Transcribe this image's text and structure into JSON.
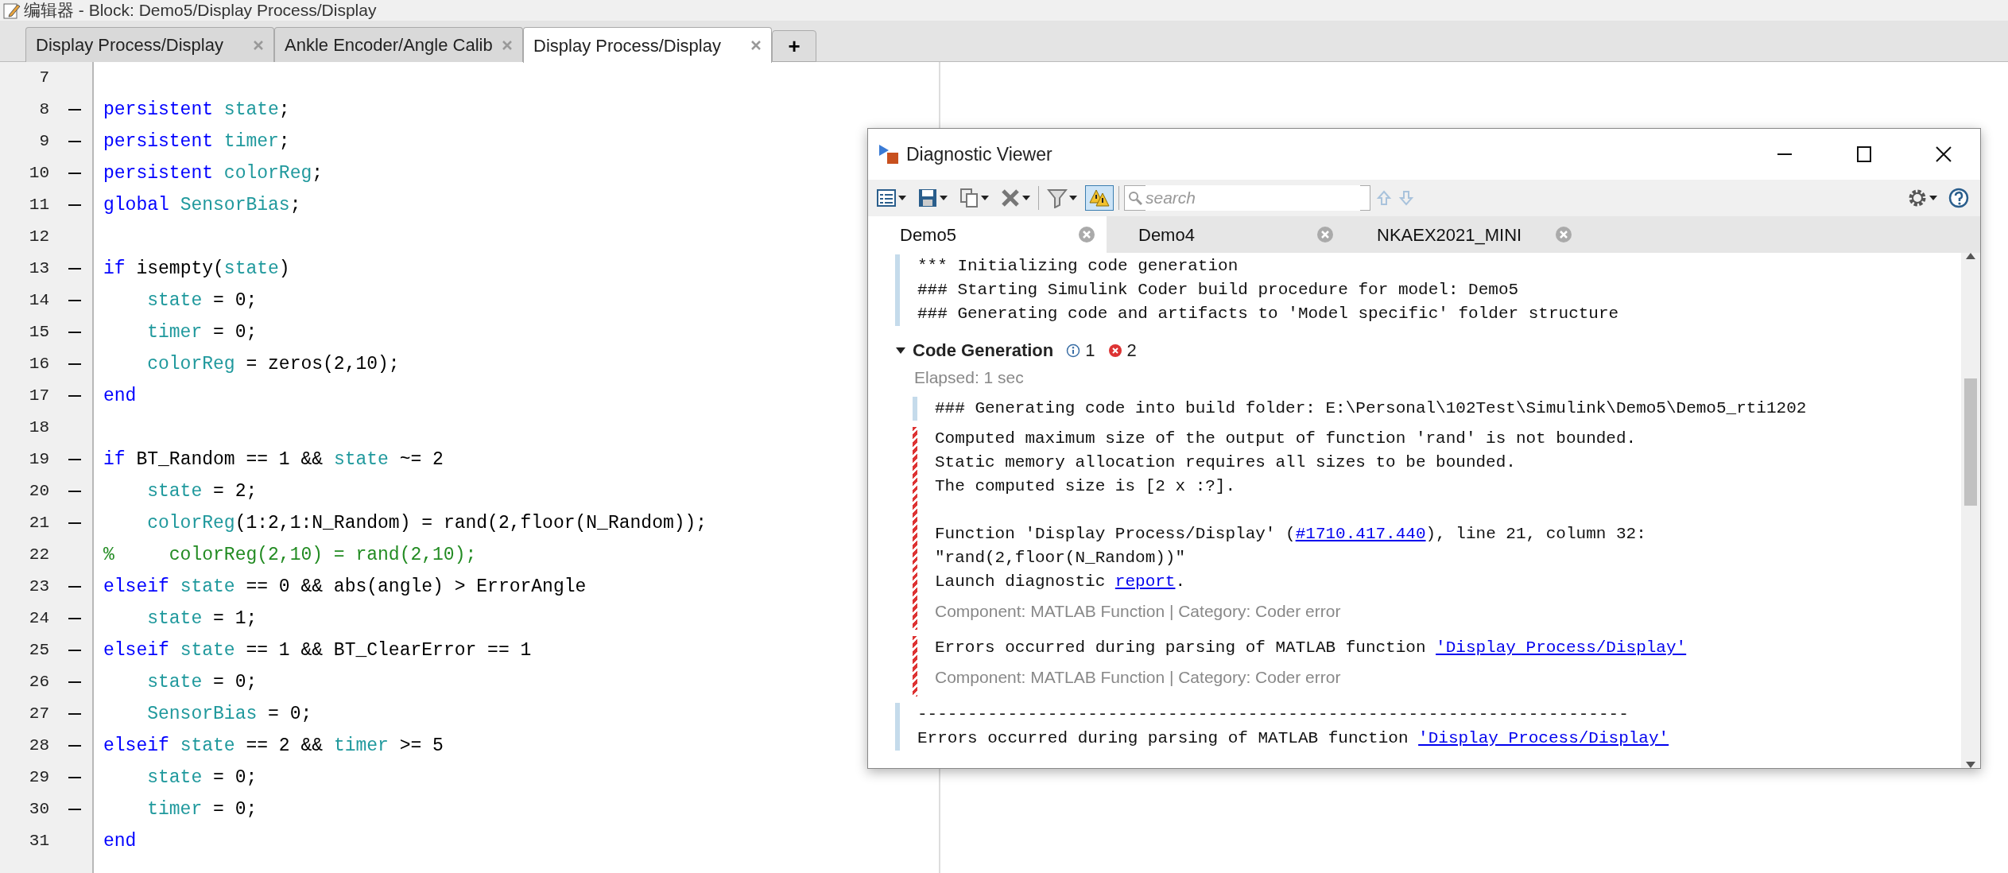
{
  "window": {
    "title": "编辑器 - Block: Demo5/Display Process/Display"
  },
  "tabs": [
    {
      "label": "Display Process/Display",
      "selected": false
    },
    {
      "label": "Ankle Encoder/Angle Calib",
      "selected": false
    },
    {
      "label": "Display Process/Display",
      "selected": true
    }
  ],
  "new_tab_button": "+",
  "code_lines": [
    {
      "number": "7",
      "executable": false
    },
    {
      "number": "8",
      "executable": true,
      "segments": [
        {
          "kind": "keyword",
          "text": "persistent "
        },
        {
          "kind": "variable",
          "text": "state"
        },
        {
          "kind": "plain",
          "text": ";"
        }
      ]
    },
    {
      "number": "9",
      "executable": true,
      "segments": [
        {
          "kind": "keyword",
          "text": "persistent "
        },
        {
          "kind": "variable",
          "text": "timer"
        },
        {
          "kind": "plain",
          "text": ";"
        }
      ]
    },
    {
      "number": "10",
      "executable": true,
      "segments": [
        {
          "kind": "keyword",
          "text": "persistent "
        },
        {
          "kind": "variable",
          "text": "colorReg"
        },
        {
          "kind": "plain",
          "text": ";"
        }
      ]
    },
    {
      "number": "11",
      "executable": true,
      "segments": [
        {
          "kind": "keyword",
          "text": "global "
        },
        {
          "kind": "variable",
          "text": "SensorBias"
        },
        {
          "kind": "plain",
          "text": ";"
        }
      ]
    },
    {
      "number": "12",
      "executable": false
    },
    {
      "number": "13",
      "executable": true,
      "segments": [
        {
          "kind": "keyword",
          "text": "if "
        },
        {
          "kind": "plain",
          "text": "isempty("
        },
        {
          "kind": "variable",
          "text": "state"
        },
        {
          "kind": "plain",
          "text": ")"
        }
      ]
    },
    {
      "number": "14",
      "executable": true,
      "segments": [
        {
          "kind": "variable",
          "text": "    state"
        },
        {
          "kind": "plain",
          "text": " = 0;"
        }
      ]
    },
    {
      "number": "15",
      "executable": true,
      "segments": [
        {
          "kind": "variable",
          "text": "    timer"
        },
        {
          "kind": "plain",
          "text": " = 0;"
        }
      ]
    },
    {
      "number": "16",
      "executable": true,
      "segments": [
        {
          "kind": "variable",
          "text": "    colorReg"
        },
        {
          "kind": "plain",
          "text": " = zeros(2,10);"
        }
      ]
    },
    {
      "number": "17",
      "executable": true,
      "segments": [
        {
          "kind": "keyword",
          "text": "end"
        }
      ]
    },
    {
      "number": "18",
      "executable": false
    },
    {
      "number": "19",
      "executable": true,
      "segments": [
        {
          "kind": "keyword",
          "text": "if "
        },
        {
          "kind": "plain",
          "text": "BT_Random == 1 && "
        },
        {
          "kind": "variable",
          "text": "state"
        },
        {
          "kind": "plain",
          "text": " ~= 2"
        }
      ]
    },
    {
      "number": "20",
      "executable": true,
      "segments": [
        {
          "kind": "variable",
          "text": "    state"
        },
        {
          "kind": "plain",
          "text": " = 2;"
        }
      ]
    },
    {
      "number": "21",
      "executable": true,
      "segments": [
        {
          "kind": "variable",
          "text": "    colorReg"
        },
        {
          "kind": "plain",
          "text": "(1:2,1:N_Random) = rand(2,floor(N_Random));"
        }
      ]
    },
    {
      "number": "22",
      "executable": false,
      "segments": [
        {
          "kind": "comment",
          "text": "%     colorReg(2,10) = rand(2,10);"
        }
      ]
    },
    {
      "number": "23",
      "executable": true,
      "segments": [
        {
          "kind": "keyword",
          "text": "elseif "
        },
        {
          "kind": "variable",
          "text": "state"
        },
        {
          "kind": "plain",
          "text": " == 0 && abs(angle) > ErrorAngle"
        }
      ]
    },
    {
      "number": "24",
      "executable": true,
      "segments": [
        {
          "kind": "variable",
          "text": "    state"
        },
        {
          "kind": "plain",
          "text": " = 1;"
        }
      ]
    },
    {
      "number": "25",
      "executable": true,
      "segments": [
        {
          "kind": "keyword",
          "text": "elseif "
        },
        {
          "kind": "variable",
          "text": "state"
        },
        {
          "kind": "plain",
          "text": " == 1 && BT_ClearError == 1"
        }
      ]
    },
    {
      "number": "26",
      "executable": true,
      "segments": [
        {
          "kind": "variable",
          "text": "    state"
        },
        {
          "kind": "plain",
          "text": " = 0;"
        }
      ]
    },
    {
      "number": "27",
      "executable": true,
      "segments": [
        {
          "kind": "variable",
          "text": "    SensorBias"
        },
        {
          "kind": "plain",
          "text": " = 0;"
        }
      ]
    },
    {
      "number": "28",
      "executable": true,
      "segments": [
        {
          "kind": "keyword",
          "text": "elseif "
        },
        {
          "kind": "variable",
          "text": "state"
        },
        {
          "kind": "plain",
          "text": " == 2 && "
        },
        {
          "kind": "variable",
          "text": "timer"
        },
        {
          "kind": "plain",
          "text": " >= 5"
        }
      ]
    },
    {
      "number": "29",
      "executable": true,
      "segments": [
        {
          "kind": "variable",
          "text": "    state"
        },
        {
          "kind": "plain",
          "text": " = 0;"
        }
      ]
    },
    {
      "number": "30",
      "executable": true,
      "segments": [
        {
          "kind": "variable",
          "text": "    timer"
        },
        {
          "kind": "plain",
          "text": " = 0;"
        }
      ]
    },
    {
      "number": "31",
      "executable": false,
      "segments": [
        {
          "kind": "keyword",
          "text": "end"
        }
      ]
    }
  ],
  "diagnostic_viewer": {
    "title": "Diagnostic Viewer",
    "warning_filter_on": true,
    "search": {
      "placeholder": "search"
    },
    "tabs": [
      {
        "label": "Demo5",
        "selected": true
      },
      {
        "label": "Demo4",
        "selected": false
      },
      {
        "label": "NKAEX2021_MINI",
        "selected": false
      }
    ],
    "log_lines": [
      "*** Initializing code generation",
      "### Starting Simulink Coder build procedure for model: Demo5",
      "### Generating code and artifacts to 'Model specific' folder structure"
    ],
    "section": {
      "title": "Code Generation",
      "expanded": true,
      "info_count": "1",
      "error_count": "2",
      "elapsed": "Elapsed: 1 sec"
    },
    "messages": [
      {
        "kind": "info",
        "paragraphs": [
          [
            [
              {
                "text": "### Generating code into build folder: E:\\Personal\\102Test\\Simulink\\Demo5\\Demo5_rti1202"
              }
            ]
          ]
        ]
      },
      {
        "kind": "error",
        "paragraphs": [
          [
            [
              {
                "text": "Computed maximum size of the output of function 'rand' is not bounded."
              }
            ],
            [
              {
                "text": "Static memory allocation requires all sizes to be bounded."
              }
            ],
            [
              {
                "text": "The computed size is [2 x :?]."
              }
            ]
          ],
          [
            [
              {
                "text": "Function 'Display Process/Display' ("
              },
              {
                "text": "#1710.417.440",
                "link": true
              },
              {
                "text": "), line 21, column 32:"
              }
            ],
            [
              {
                "text": "\"rand(2,floor(N_Random))\""
              }
            ],
            [
              {
                "text": "Launch diagnostic "
              },
              {
                "text": "report",
                "link": true
              },
              {
                "text": "."
              }
            ]
          ]
        ],
        "footer": "Component: MATLAB Function | Category: Coder error"
      },
      {
        "kind": "error",
        "paragraphs": [
          [
            [
              {
                "text": "Errors occurred during parsing of MATLAB function "
              },
              {
                "text": "'Display Process/Display'",
                "link": true
              }
            ]
          ]
        ],
        "footer": "Component: MATLAB Function | Category: Coder error"
      }
    ],
    "trailing_lines": [
      [
        {
          "text": "-----------------------------------------------------------------------"
        }
      ],
      [
        {
          "text": "Errors occurred during parsing of MATLAB function "
        },
        {
          "text": "'Display Process/Display'",
          "link": true
        }
      ]
    ]
  }
}
